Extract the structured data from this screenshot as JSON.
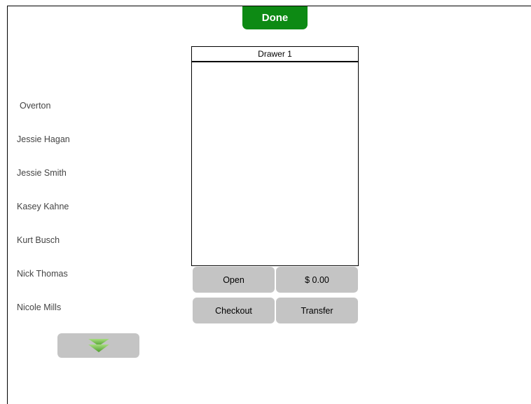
{
  "header": {
    "done_label": "Done"
  },
  "drawer": {
    "title": "Drawer 1",
    "open_label": "Open",
    "amount": "$ 0.00",
    "checkout_label": "Checkout",
    "transfer_label": "Transfer"
  },
  "employees": [
    {
      "name": "Overton"
    },
    {
      "name": "Jessie Hagan"
    },
    {
      "name": "Jessie Smith"
    },
    {
      "name": "Kasey Kahne"
    },
    {
      "name": "Kurt Busch"
    },
    {
      "name": "Nick Thomas"
    },
    {
      "name": "Nicole Mills"
    }
  ],
  "scroll": {
    "icon": "chevron-double-down-icon",
    "color": "#6dbb4a"
  },
  "colors": {
    "done_bg": "#0d8a14",
    "button_bg": "#c4c4c4"
  }
}
